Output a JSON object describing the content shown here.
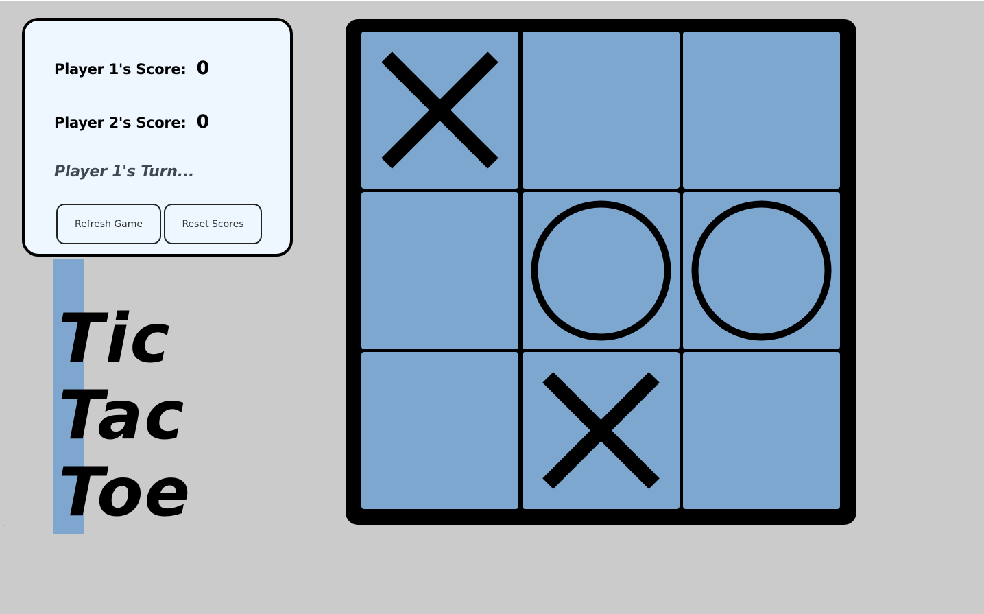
{
  "scoreboard": {
    "player1_label": "Player 1's Score:",
    "player1_score": "0",
    "player2_label": "Player 2's Score:",
    "player2_score": "0",
    "turn_text": "Player 1's Turn...",
    "refresh_label": "Refresh Game",
    "reset_label": "Reset Scores"
  },
  "title": {
    "line1": "Tic",
    "line2": "Tac",
    "line3": "Toe"
  },
  "board": {
    "cells": [
      "X",
      "",
      "",
      "",
      "O",
      "O",
      "",
      "X",
      ""
    ]
  },
  "colors": {
    "background": "#cbcbcb",
    "panel": "#eef7ff",
    "cell": "#7ea7cf",
    "accent": "#7ea6cf",
    "board_frame": "#000000"
  }
}
